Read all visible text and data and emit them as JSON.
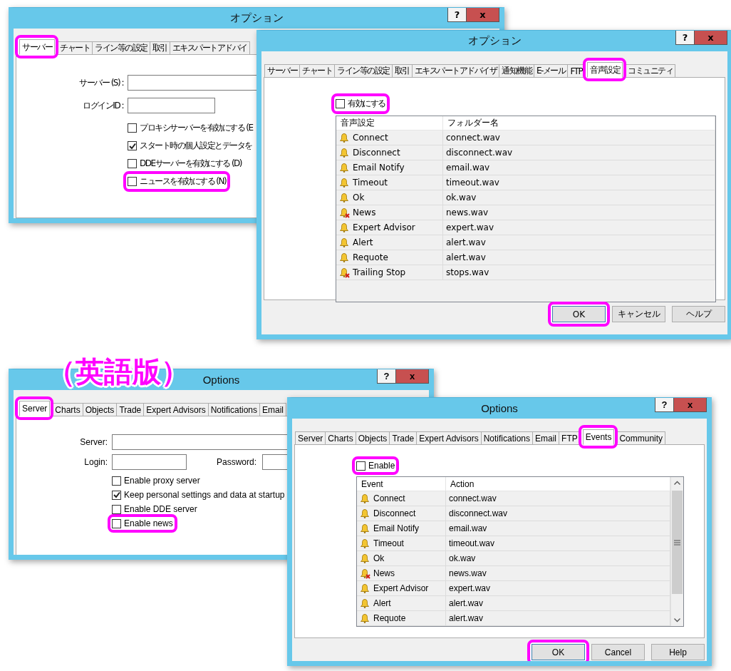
{
  "label": "（英語版）",
  "windows": [
    {
      "kind": "server",
      "title": "オプション",
      "help_button": "?",
      "close_button": "x",
      "tabs": [
        {
          "label": "サーバー",
          "selected": true,
          "highlighted": true
        },
        {
          "label": "チャート",
          "selected": false,
          "highlighted": false
        },
        {
          "label": "ライン等の設定",
          "selected": false,
          "highlighted": false
        },
        {
          "label": "取引",
          "selected": false,
          "highlighted": false
        },
        {
          "label": "エキスパートアドバイ",
          "selected": false,
          "highlighted": false
        }
      ],
      "fields": [
        [
          {
            "label": "サーバー (S) :"
          }
        ],
        [
          {
            "label": "ログインID :"
          }
        ]
      ],
      "checkboxes": [
        {
          "label": "プロキシサーバーを有効にする (E",
          "checked": false,
          "highlighted": false
        },
        {
          "label": "スタート時の個人設定とデータを",
          "checked": true,
          "highlighted": false
        },
        {
          "label": "DDEサーバーを有効にする (D)",
          "checked": false,
          "highlighted": false
        },
        {
          "label": "ニュースを有効にする (N)",
          "checked": false,
          "highlighted": true
        }
      ]
    },
    {
      "kind": "events",
      "title": "オプション",
      "help_button": "?",
      "close_button": "x",
      "scrollbar": false,
      "tabs": [
        {
          "label": "サーバー",
          "selected": false,
          "highlighted": false
        },
        {
          "label": "チャート",
          "selected": false,
          "highlighted": false
        },
        {
          "label": "ライン等の設定",
          "selected": false,
          "highlighted": false
        },
        {
          "label": "取引",
          "selected": false,
          "highlighted": false
        },
        {
          "label": "エキスパートアドバイザ",
          "selected": false,
          "highlighted": false
        },
        {
          "label": "通知機能",
          "selected": false,
          "highlighted": false
        },
        {
          "label": "E-メール",
          "selected": false,
          "highlighted": false
        },
        {
          "label": "FTP",
          "selected": false,
          "highlighted": false
        },
        {
          "label": "音声設定",
          "selected": true,
          "highlighted": true
        },
        {
          "label": "コミュニティ",
          "selected": false,
          "highlighted": false
        }
      ],
      "events_checkbox": {
        "label": "有効にする",
        "checked": false,
        "highlighted": true
      },
      "columns": [
        "音声設定",
        "フォルダー名"
      ],
      "rows": [
        {
          "event": "Connect",
          "file": "connect.wav",
          "enabled": true
        },
        {
          "event": "Disconnect",
          "file": "disconnect.wav",
          "enabled": true
        },
        {
          "event": "Email Notify",
          "file": "email.wav",
          "enabled": true
        },
        {
          "event": "Timeout",
          "file": "timeout.wav",
          "enabled": true
        },
        {
          "event": "Ok",
          "file": "ok.wav",
          "enabled": true
        },
        {
          "event": "News",
          "file": "news.wav",
          "enabled": false
        },
        {
          "event": "Expert Advisor",
          "file": "expert.wav",
          "enabled": true
        },
        {
          "event": "Alert",
          "file": "alert.wav",
          "enabled": true
        },
        {
          "event": "Requote",
          "file": "alert.wav",
          "enabled": true
        },
        {
          "event": "Trailing Stop",
          "file": "stops.wav",
          "enabled": false
        }
      ],
      "buttons": [
        {
          "label": "OK",
          "highlighted": true
        },
        {
          "label": "キャンセル",
          "highlighted": false
        },
        {
          "label": "ヘルプ",
          "highlighted": false
        }
      ]
    },
    {
      "kind": "server",
      "title": "Options",
      "help_button": "?",
      "close_button": "x",
      "tabs": [
        {
          "label": "Server",
          "selected": true,
          "highlighted": true
        },
        {
          "label": "Charts",
          "selected": false,
          "highlighted": false
        },
        {
          "label": "Objects",
          "selected": false,
          "highlighted": false
        },
        {
          "label": "Trade",
          "selected": false,
          "highlighted": false
        },
        {
          "label": "Expert Advisors",
          "selected": false,
          "highlighted": false
        },
        {
          "label": "Notifications",
          "selected": false,
          "highlighted": false
        },
        {
          "label": "Email",
          "selected": false,
          "highlighted": false
        }
      ],
      "fields": [
        [
          {
            "label": "Server:"
          }
        ],
        [
          {
            "label": "Login:"
          },
          {
            "label": "Password:"
          }
        ]
      ],
      "checkboxes": [
        {
          "label": "Enable proxy server",
          "checked": false,
          "highlighted": false
        },
        {
          "label": "Keep personal settings and data at startup",
          "checked": true,
          "highlighted": false
        },
        {
          "label": "Enable DDE server",
          "checked": false,
          "highlighted": false
        },
        {
          "label": "Enable news",
          "checked": false,
          "highlighted": true
        }
      ]
    },
    {
      "kind": "events",
      "title": "Options",
      "help_button": "?",
      "close_button": "x",
      "scrollbar": true,
      "tabs": [
        {
          "label": "Server",
          "selected": false,
          "highlighted": false
        },
        {
          "label": "Charts",
          "selected": false,
          "highlighted": false
        },
        {
          "label": "Objects",
          "selected": false,
          "highlighted": false
        },
        {
          "label": "Trade",
          "selected": false,
          "highlighted": false
        },
        {
          "label": "Expert Advisors",
          "selected": false,
          "highlighted": false
        },
        {
          "label": "Notifications",
          "selected": false,
          "highlighted": false
        },
        {
          "label": "Email",
          "selected": false,
          "highlighted": false
        },
        {
          "label": "FTP",
          "selected": false,
          "highlighted": false
        },
        {
          "label": "Events",
          "selected": true,
          "highlighted": true
        },
        {
          "label": "Community",
          "selected": false,
          "highlighted": false
        }
      ],
      "events_checkbox": {
        "label": "Enable",
        "checked": false,
        "highlighted": true
      },
      "columns": [
        "Event",
        "Action"
      ],
      "rows": [
        {
          "event": "Connect",
          "file": "connect.wav",
          "enabled": true
        },
        {
          "event": "Disconnect",
          "file": "disconnect.wav",
          "enabled": true
        },
        {
          "event": "Email Notify",
          "file": "email.wav",
          "enabled": true
        },
        {
          "event": "Timeout",
          "file": "timeout.wav",
          "enabled": true
        },
        {
          "event": "Ok",
          "file": "ok.wav",
          "enabled": true
        },
        {
          "event": "News",
          "file": "news.wav",
          "enabled": false
        },
        {
          "event": "Expert Advisor",
          "file": "expert.wav",
          "enabled": true
        },
        {
          "event": "Alert",
          "file": "alert.wav",
          "enabled": true
        },
        {
          "event": "Requote",
          "file": "alert.wav",
          "enabled": true
        }
      ],
      "buttons": [
        {
          "label": "OK",
          "highlighted": true
        },
        {
          "label": "Cancel",
          "highlighted": false
        },
        {
          "label": "Help",
          "highlighted": false
        }
      ]
    }
  ]
}
